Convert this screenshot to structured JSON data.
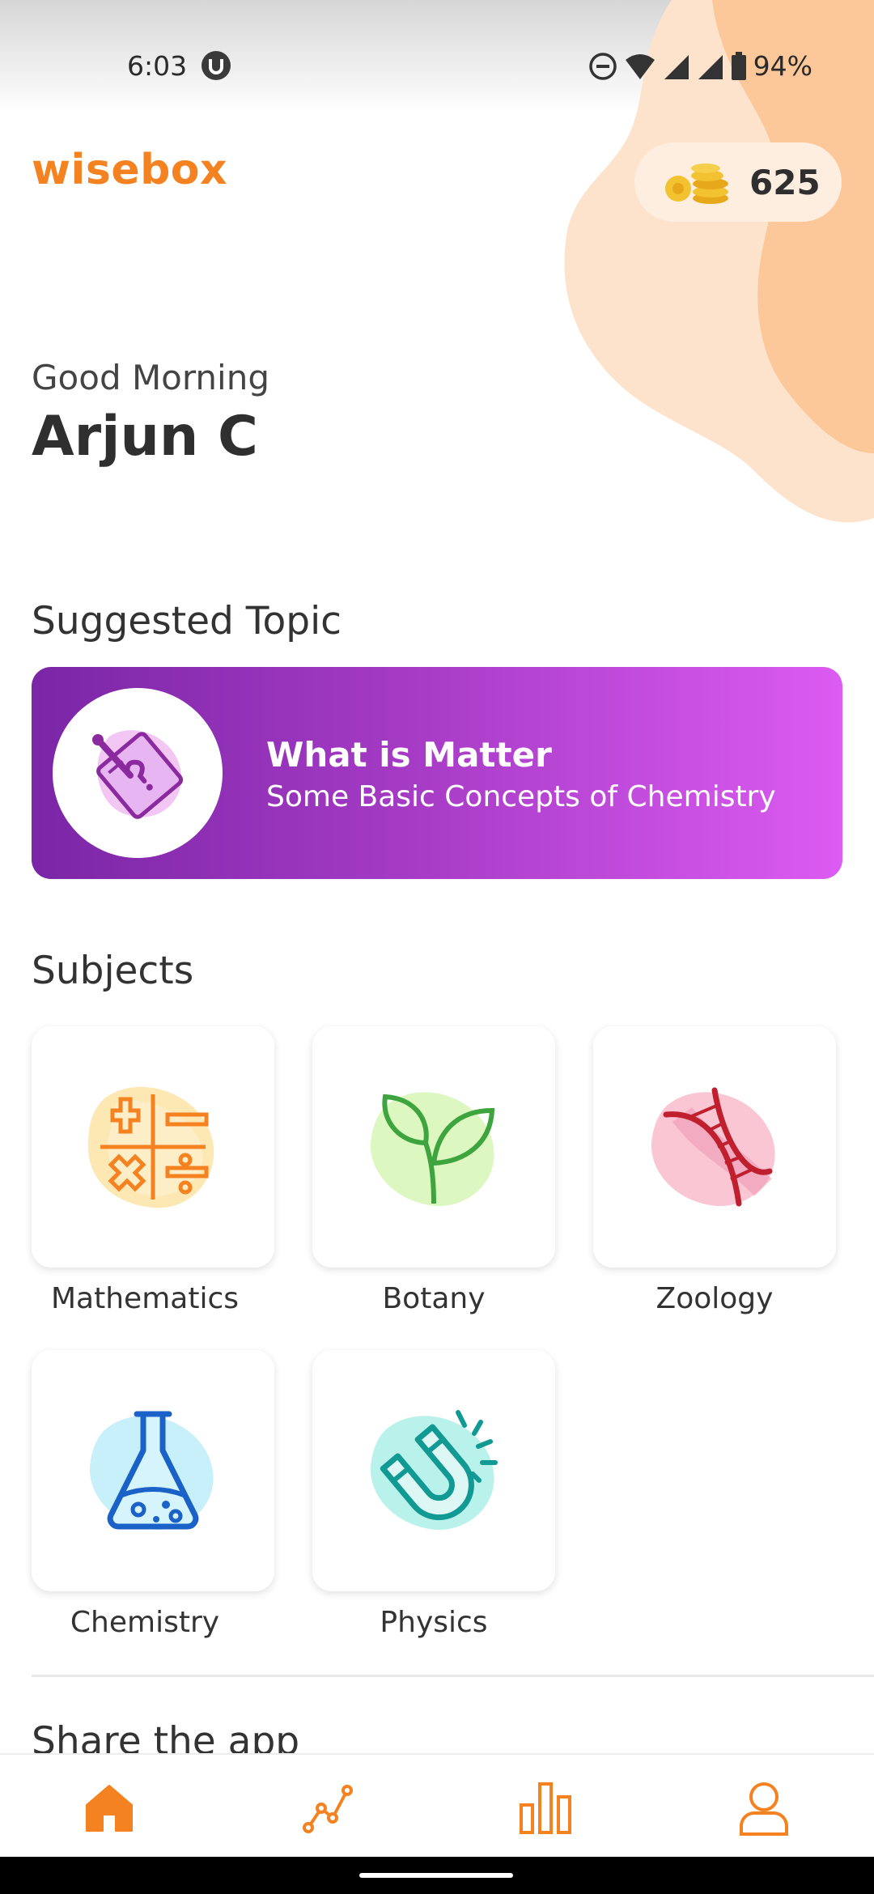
{
  "status_bar": {
    "time": "6:03",
    "battery": "94%"
  },
  "header": {
    "brand": "wisebox",
    "coins": "625"
  },
  "greeting": {
    "salutation": "Good Morning",
    "name": "Arjun C"
  },
  "suggested": {
    "section_title": "Suggested Topic",
    "topic_title": "What is Matter",
    "topic_subtitle": "Some Basic Concepts of Chemistry"
  },
  "subjects": {
    "section_title": "Subjects",
    "items": [
      {
        "label": "Mathematics",
        "icon": "math-symbols-icon"
      },
      {
        "label": "Botany",
        "icon": "plant-sprout-icon"
      },
      {
        "label": "Zoology",
        "icon": "dna-icon"
      },
      {
        "label": "Chemistry",
        "icon": "flask-icon"
      },
      {
        "label": "Physics",
        "icon": "magnet-icon"
      }
    ]
  },
  "share": {
    "title": "Share the app"
  },
  "bottom_nav": [
    "home-icon",
    "progress-line-icon",
    "leaderboard-icon",
    "profile-icon"
  ],
  "colors": {
    "accent": "#f58220",
    "card_start": "#7a26a6",
    "card_end": "#dc5bf2"
  }
}
